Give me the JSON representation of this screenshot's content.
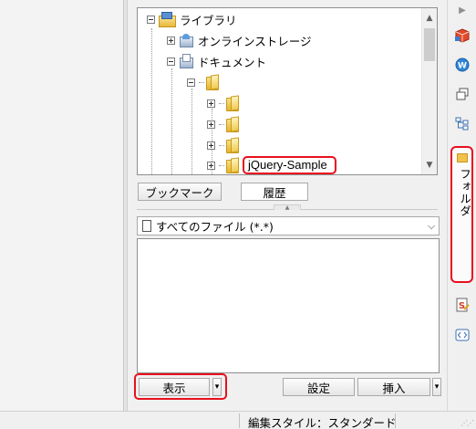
{
  "tree": {
    "items": [
      {
        "label": "ライブラリ",
        "icon": "library-icon",
        "expanded": true
      },
      {
        "label": "オンラインストレージ",
        "icon": "online-storage-icon",
        "expanded": false
      },
      {
        "label": "ドキュメント",
        "icon": "documents-icon",
        "expanded": true
      },
      {
        "label": "",
        "icon": "folder-icon",
        "expanded": true
      },
      {
        "label": "",
        "icon": "folder-icon",
        "expanded": false
      },
      {
        "label": "",
        "icon": "folder-icon",
        "expanded": false
      },
      {
        "label": "",
        "icon": "folder-icon",
        "expanded": false
      },
      {
        "label": "jQuery-Sample",
        "icon": "folder-icon",
        "expanded": false,
        "highlighted": true
      }
    ]
  },
  "tabs": {
    "bookmark": "ブックマーク",
    "history": "履歴"
  },
  "filter": {
    "label": "すべてのファイル (*.*)"
  },
  "buttons": {
    "show": "表示",
    "settings": "設定",
    "insert": "挿入"
  },
  "right_bar": {
    "folder_tab": "フォルダ"
  },
  "status": {
    "edit_style": "編集スタイル：スタンダード"
  },
  "colors": {
    "highlight": "#e8101e"
  }
}
